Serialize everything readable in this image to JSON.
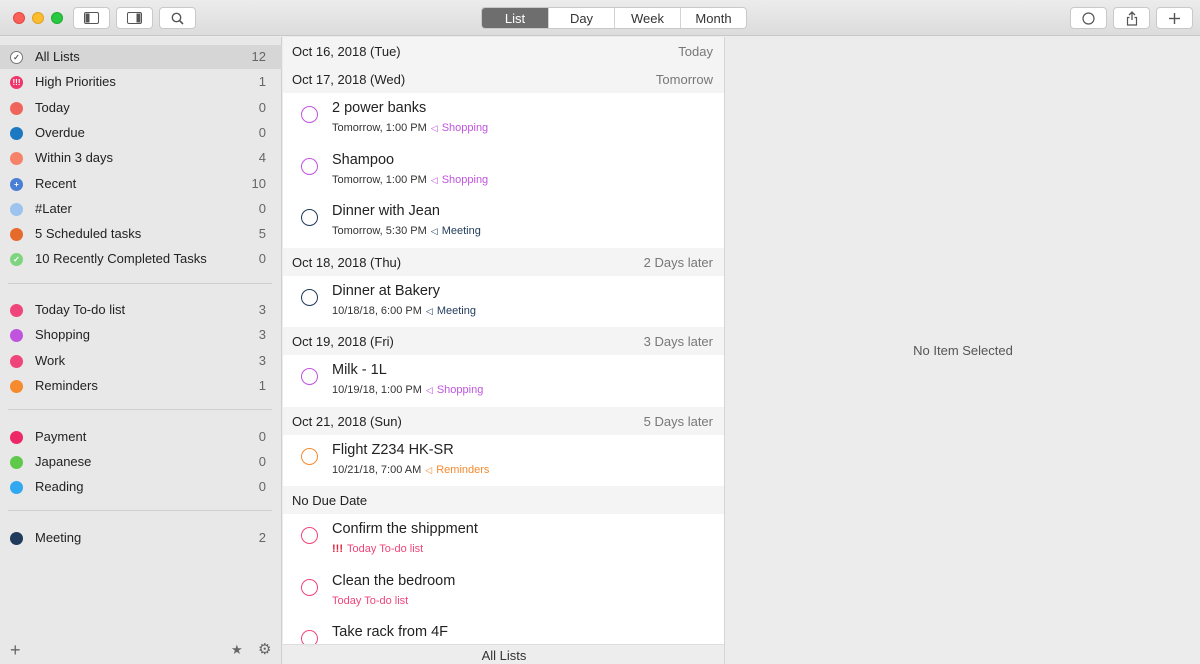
{
  "toolbar": {
    "views": [
      "List",
      "Day",
      "Week",
      "Month"
    ],
    "active_view": "List"
  },
  "sidebar": {
    "smart_lists": [
      {
        "label": "All Lists",
        "count": "12",
        "color": "#ffffff",
        "glyph": "✓",
        "selected": true
      },
      {
        "label": "High Priorities",
        "count": "1",
        "color": "#f0356b",
        "glyph": "!!!"
      },
      {
        "label": "Today",
        "count": "0",
        "color": "#f0655b",
        "glyph": ""
      },
      {
        "label": "Overdue",
        "count": "0",
        "color": "#1c78c0",
        "glyph": ""
      },
      {
        "label": "Within 3 days",
        "count": "4",
        "color": "#f6826a",
        "glyph": ""
      },
      {
        "label": "Recent",
        "count": "10",
        "color": "#4a7fd6",
        "glyph": "+"
      },
      {
        "label": "#Later",
        "count": "0",
        "color": "#9cc4ee",
        "glyph": ""
      },
      {
        "label": "5 Scheduled tasks",
        "count": "5",
        "color": "#e66a2c",
        "glyph": ""
      },
      {
        "label": "10 Recently Completed Tasks",
        "count": "0",
        "color": "#7fd47f",
        "glyph": "✓"
      }
    ],
    "lists_group1": [
      {
        "label": "Today To-do list",
        "count": "3",
        "color": "#f0457a"
      },
      {
        "label": "Shopping",
        "count": "3",
        "color": "#c154df"
      },
      {
        "label": "Work",
        "count": "3",
        "color": "#f0457a"
      },
      {
        "label": "Reminders",
        "count": "1",
        "color": "#f58a2f"
      }
    ],
    "lists_group2": [
      {
        "label": "Payment",
        "count": "0",
        "color": "#ee2767"
      },
      {
        "label": "Japanese",
        "count": "0",
        "color": "#5ec94a"
      },
      {
        "label": "Reading",
        "count": "0",
        "color": "#31a8f0"
      }
    ],
    "lists_group3": [
      {
        "label": "Meeting",
        "count": "2",
        "color": "#1f3a5a"
      }
    ]
  },
  "main": {
    "sections": [
      {
        "date": "Oct 16, 2018 (Tue)",
        "relative": "Today",
        "tasks": []
      },
      {
        "date": "Oct 17, 2018 (Wed)",
        "relative": "Tomorrow",
        "tasks": [
          {
            "title": "2 power banks",
            "when": "Tomorrow, 1:00 PM",
            "list": "Shopping",
            "color": "#c154df",
            "prefix": ""
          },
          {
            "title": "Shampoo",
            "when": "Tomorrow, 1:00 PM",
            "list": "Shopping",
            "color": "#c154df",
            "prefix": ""
          },
          {
            "title": "Dinner with Jean",
            "when": "Tomorrow, 5:30 PM",
            "list": "Meeting",
            "color": "#1f3a5a",
            "prefix": ""
          }
        ]
      },
      {
        "date": "Oct 18, 2018 (Thu)",
        "relative": "2 Days later",
        "tasks": [
          {
            "title": "Dinner at Bakery",
            "when": "10/18/18, 6:00 PM",
            "list": "Meeting",
            "color": "#1f3a5a",
            "prefix": ""
          }
        ]
      },
      {
        "date": "Oct 19, 2018 (Fri)",
        "relative": "3 Days later",
        "tasks": [
          {
            "title": "Milk - 1L",
            "when": "10/19/18, 1:00 PM",
            "list": "Shopping",
            "color": "#c154df",
            "prefix": ""
          }
        ]
      },
      {
        "date": "Oct 21, 2018 (Sun)",
        "relative": "5 Days later",
        "tasks": [
          {
            "title": "Flight Z234 HK-SR",
            "when": "10/21/18, 7:00 AM",
            "list": "Reminders",
            "color": "#f58a2f",
            "prefix": ""
          }
        ]
      },
      {
        "date": "No Due Date",
        "relative": "",
        "tasks": [
          {
            "title": "Confirm the shippment",
            "when": "",
            "list": "Today To-do list",
            "color": "#f0457a",
            "prefix": "!!!"
          },
          {
            "title": "Clean the bedroom",
            "when": "",
            "list": "Today To-do list",
            "color": "#f0457a",
            "prefix": ""
          },
          {
            "title": "Take rack from 4F",
            "when": "",
            "list": "",
            "color": "#f0457a",
            "prefix": ""
          }
        ]
      }
    ],
    "footer": "All Lists"
  },
  "detail": {
    "empty_text": "No Item Selected"
  }
}
